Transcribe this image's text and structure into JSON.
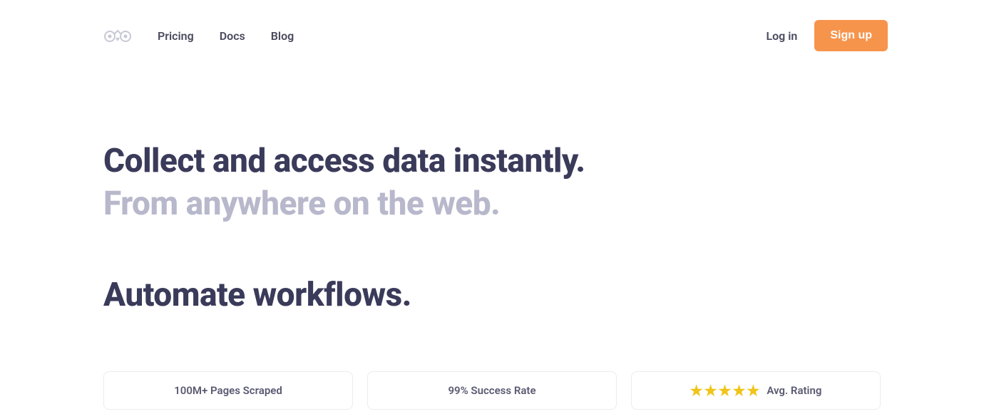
{
  "nav": {
    "links": [
      {
        "label": "Pricing"
      },
      {
        "label": "Docs"
      },
      {
        "label": "Blog"
      }
    ],
    "login": "Log in",
    "signup": "Sign up"
  },
  "hero": {
    "line1": "Collect and access data instantly.",
    "line2": "From anywhere on the web.",
    "sub": "Automate workflows."
  },
  "stats": {
    "card1": "100M+ Pages Scraped",
    "card2": "99% Success Rate",
    "card3_label": "Avg. Rating",
    "card3_stars": 5
  }
}
